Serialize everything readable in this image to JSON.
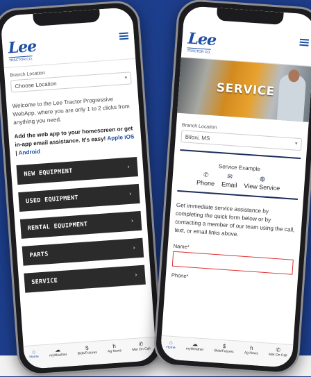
{
  "left_phone": {
    "logo": "Lee",
    "logo_sub": "TRACTOR CO.",
    "branch_label": "Branch Location",
    "branch_placeholder": "Choose Location",
    "welcome": "Welcome to the Lee Tractor Progressive WebApp, where you are only 1 to 2 clicks from anything you need.",
    "add_app_text": "Add the web app to your homescreen or get in-app email assistance. It's easy!",
    "apple_link": "Apple iOS",
    "separator": "|",
    "android_link": "Android",
    "menu": [
      {
        "label": "NEW EQUIPMENT"
      },
      {
        "label": "USED EQUIPMENT"
      },
      {
        "label": "RENTAL EQUIPMENT"
      },
      {
        "label": "PARTS"
      },
      {
        "label": "SERVICE"
      }
    ]
  },
  "right_phone": {
    "logo": "Lee",
    "logo_sub": "TRACTOR CO.",
    "hero_title": "SERVICE",
    "branch_label": "Branch Location",
    "branch_value": "Biloxi, MS",
    "section_title": "Service Example",
    "contacts": [
      {
        "icon": "phone-icon",
        "glyph": "✆",
        "label": "Phone"
      },
      {
        "icon": "email-icon",
        "glyph": "✉",
        "label": "Email"
      },
      {
        "icon": "globe-icon",
        "glyph": "◍",
        "label": "View Service"
      }
    ],
    "service_text": "Get immediate service assistance by completing the quick form below or by contacting a member of our team using the call, text, or email links above.",
    "name_label": "Name*",
    "phone_label": "Phone*"
  },
  "tabbar": [
    {
      "icon": "home-icon",
      "glyph": "⌂",
      "label": "Home"
    },
    {
      "icon": "weather-icon",
      "glyph": "☁",
      "label": "myWeather"
    },
    {
      "icon": "dollar-icon",
      "glyph": "$",
      "label": "Bids/Futures"
    },
    {
      "icon": "news-icon",
      "glyph": "h",
      "label": "Ag News"
    },
    {
      "icon": "call-icon",
      "glyph": "✆",
      "label": "Met On Call"
    }
  ]
}
